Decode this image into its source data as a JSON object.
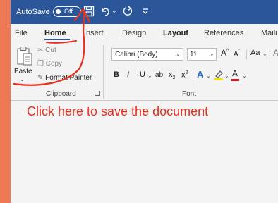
{
  "titlebar": {
    "autosave_label": "AutoSave",
    "toggle_state": "Off"
  },
  "tabs": [
    "File",
    "Home",
    "Insert",
    "Design",
    "Layout",
    "References",
    "Maili"
  ],
  "active_tab": "Home",
  "clipboard": {
    "paste_label": "Paste",
    "cut_label": "Cut",
    "copy_label": "Copy",
    "format_painter_label": "Format Painter",
    "group_label": "Clipboard"
  },
  "font": {
    "font_name": "Calibri (Body)",
    "font_size": "11",
    "group_label": "Font",
    "bold": "B",
    "italic": "I",
    "underline": "U",
    "strikethrough": "ab",
    "subscript": "x",
    "superscript": "x",
    "text_effects": "A",
    "highlight": "",
    "font_color": "A",
    "grow": "A",
    "shrink": "A",
    "change_case": "Aa"
  },
  "annotation": {
    "text": "Click here to save the document",
    "color": "#e8301f"
  },
  "colors": {
    "titlebar": "#2b579a",
    "left_strip": "#ee7a55",
    "highlight": "#f2e400",
    "font_color_bar": "#e81123"
  }
}
